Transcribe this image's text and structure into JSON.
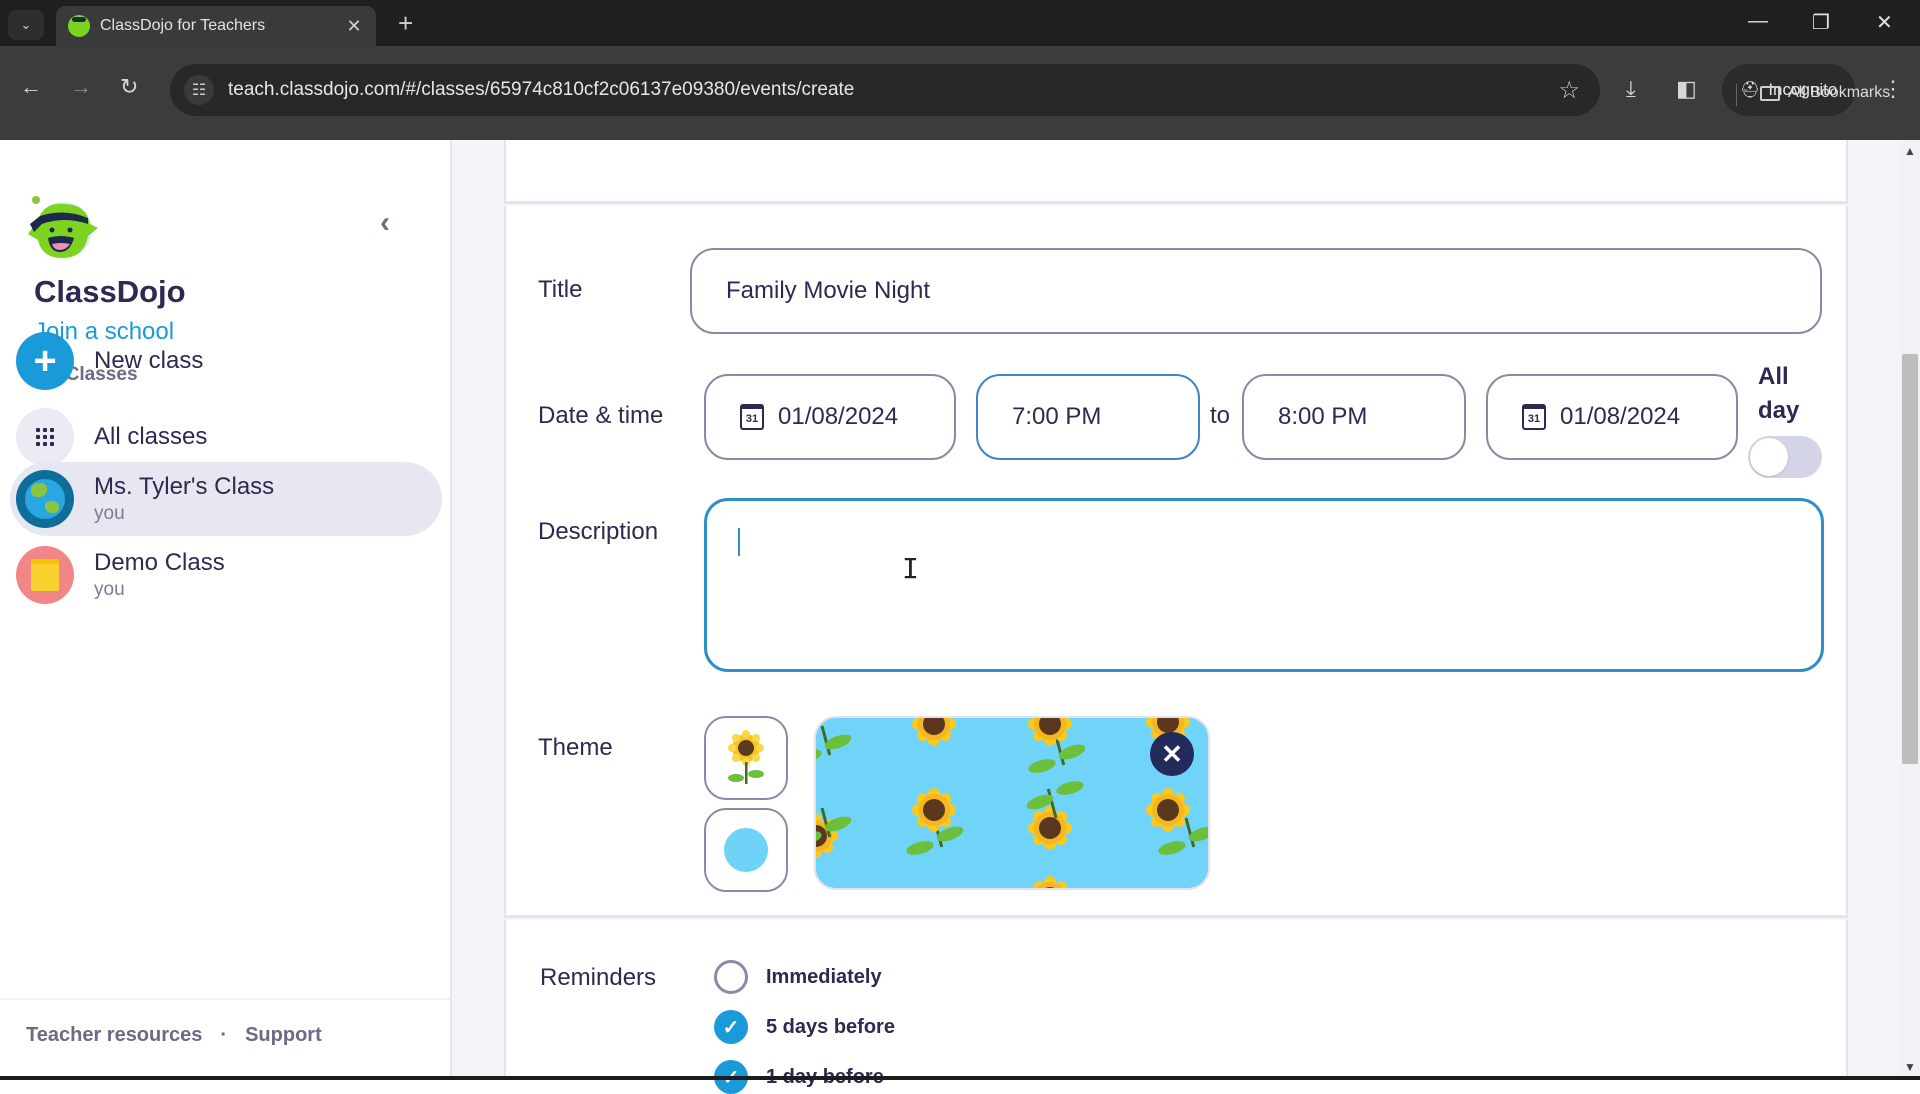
{
  "browser": {
    "tab_title": "ClassDojo for Teachers",
    "url": "teach.classdojo.com/#/classes/65974c810cf2c06137e09380/events/create",
    "incognito_label": "Incognito",
    "bookmarks_label": "All Bookmarks",
    "icons": {
      "tab_menu": "chevron-down-icon",
      "tab_close": "close-icon",
      "new_tab": "plus-icon",
      "back": "arrow-left-icon",
      "forward": "arrow-right-icon",
      "reload": "reload-icon",
      "site_info": "tune-icon",
      "bookmark": "star-icon",
      "download": "download-icon",
      "side_panel": "side-panel-icon",
      "menu": "kebab-menu-icon"
    },
    "glyphs": {
      "chevron_down": "⌄",
      "close": "✕",
      "plus": "+",
      "back": "←",
      "forward": "→",
      "reload": "↻",
      "site_info": "☷",
      "star": "☆",
      "download": "⤓",
      "side_panel": "◧",
      "incognito": "🕵",
      "kebab": "⋮",
      "minimize": "—",
      "restore": "❐",
      "window_close": "✕"
    }
  },
  "sidebar": {
    "brand": "ClassDojo",
    "join_school": "Join a school",
    "collapse_glyph": "‹",
    "section_title": "My Classes",
    "items": [
      {
        "label": "New class",
        "sub": "",
        "avatar": "plus-icon",
        "glyph": "+"
      },
      {
        "label": "All classes",
        "sub": "",
        "avatar": "grid-icon"
      },
      {
        "label": "Ms. Tyler's Class",
        "sub": "you",
        "avatar": "globe-icon",
        "active": true
      },
      {
        "label": "Demo Class",
        "sub": "you",
        "avatar": "notepad-icon"
      }
    ],
    "footer": {
      "teacher_resources": "Teacher resources",
      "separator": "·",
      "support": "Support"
    }
  },
  "form": {
    "title_label": "Title",
    "title_value": "Family Movie Night",
    "datetime_label": "Date & time",
    "start_date": "01/08/2024",
    "start_time": "7:00 PM",
    "to_label": "to",
    "end_time": "8:00 PM",
    "end_date": "01/08/2024",
    "calendar_icon_text": "31",
    "all_day_label_1": "All",
    "all_day_label_2": "day",
    "all_day_enabled": false,
    "description_label": "Description",
    "description_value": "",
    "theme_label": "Theme",
    "theme_selected": "sunflowers",
    "theme_close_glyph": "✕",
    "reminders_label": "Reminders",
    "reminders": [
      {
        "label": "Immediately",
        "checked": false
      },
      {
        "label": "5 days before",
        "checked": true
      },
      {
        "label": "1 day before",
        "checked": true
      }
    ],
    "check_glyph": "✓"
  },
  "colors": {
    "accent_blue": "#1a9ad9",
    "text_dark": "#2c2a50",
    "theme_sky": "#70d4f8",
    "close_badge": "#232a5c"
  }
}
